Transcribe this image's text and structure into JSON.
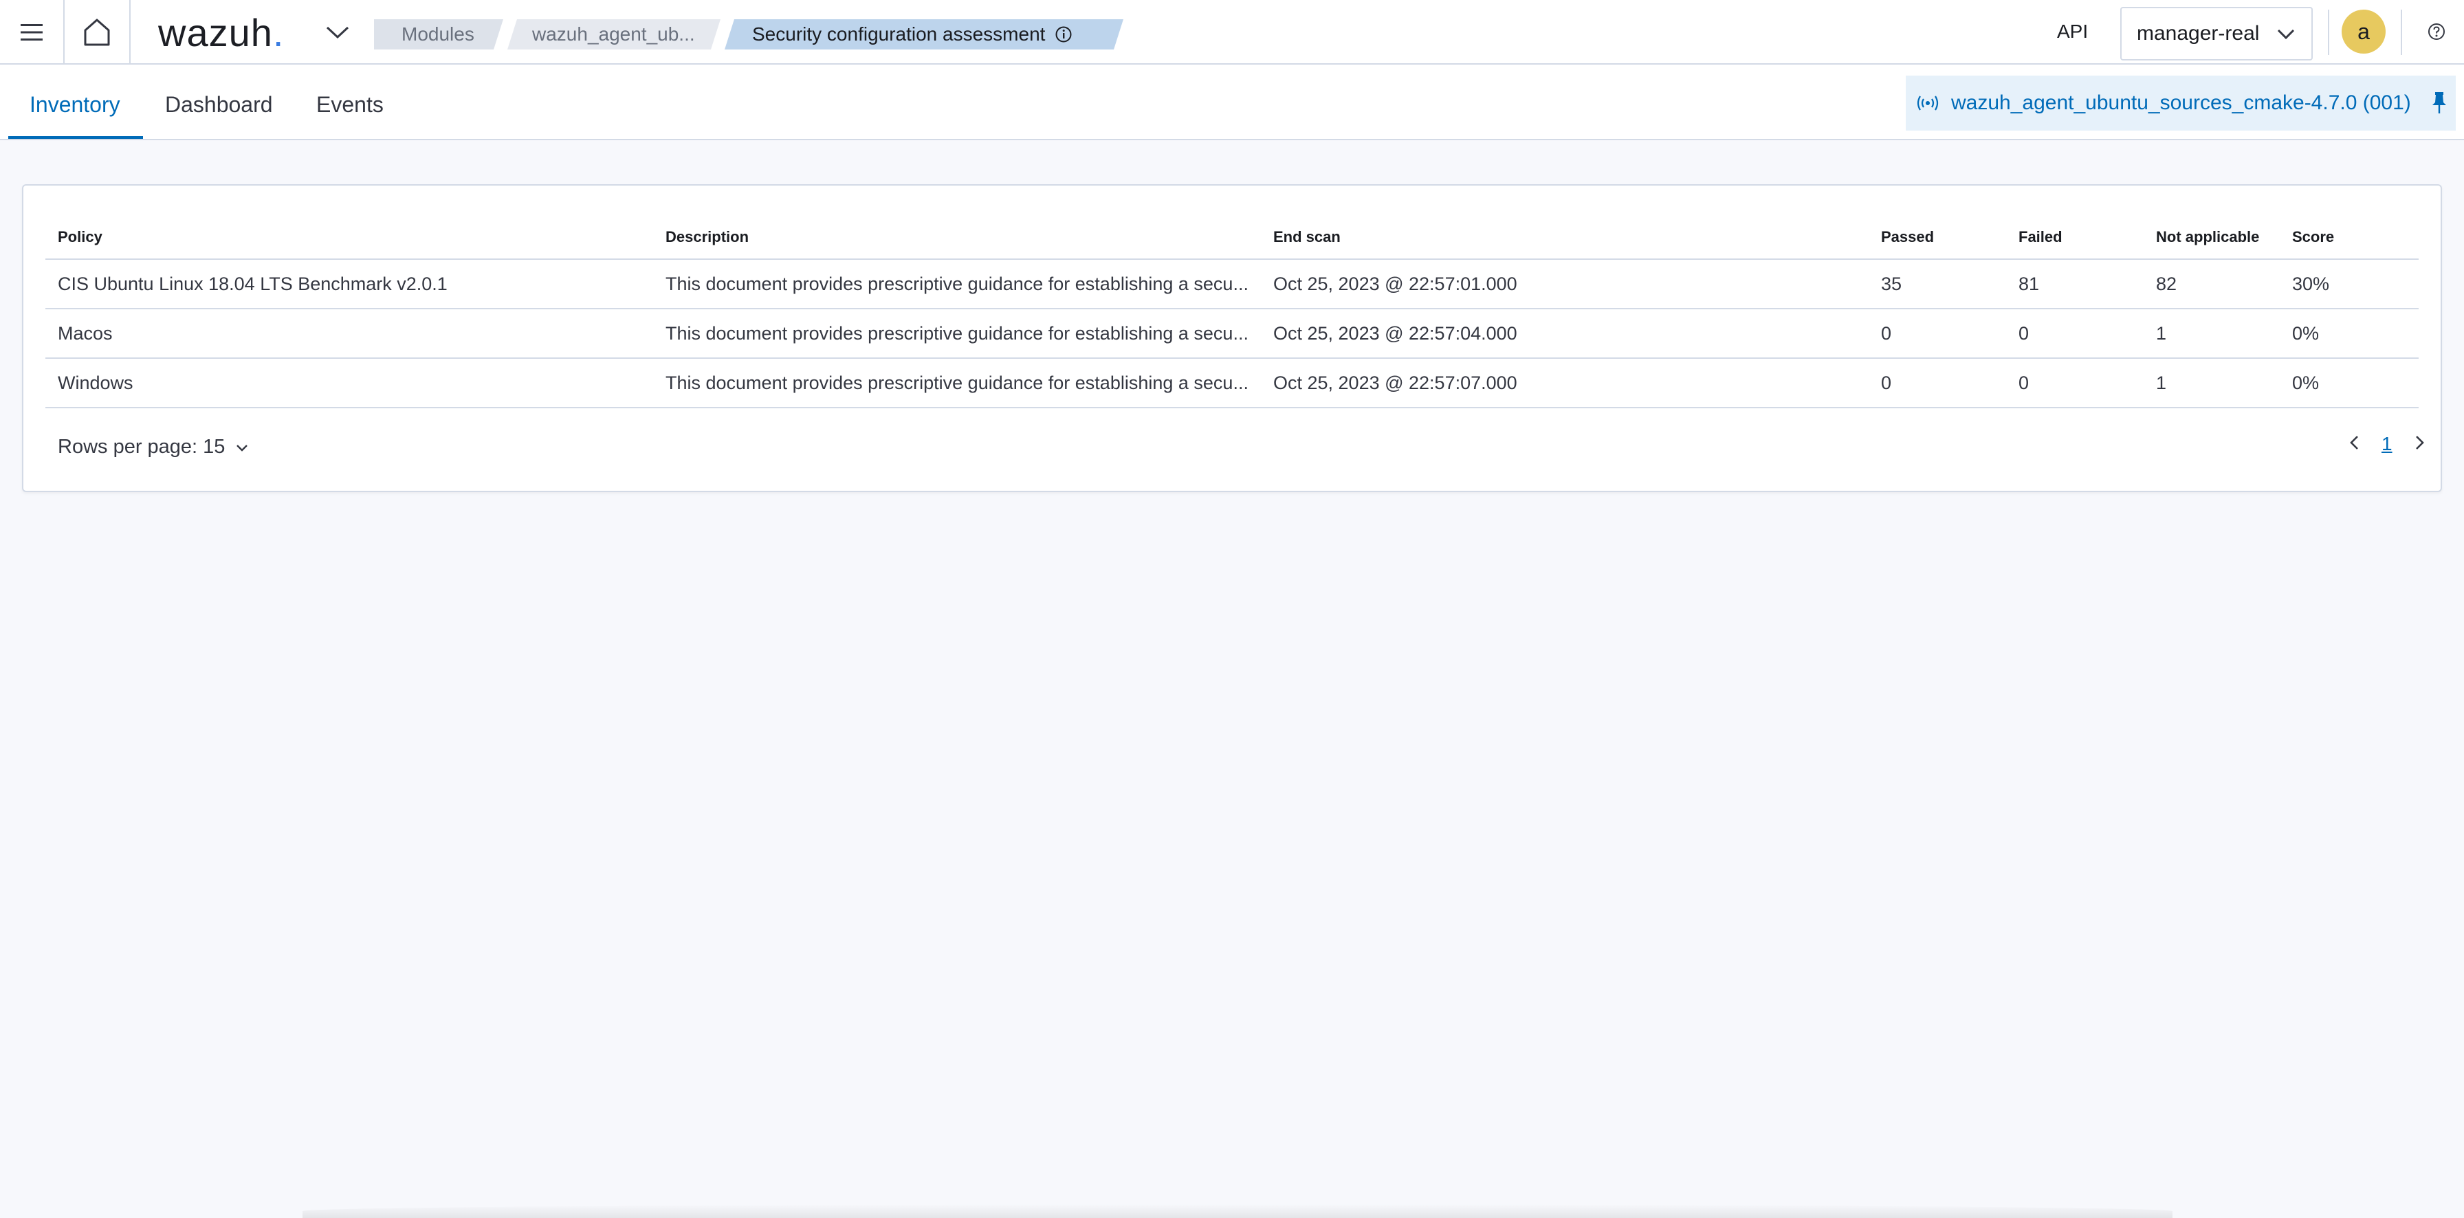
{
  "header": {
    "logo_text": "wazuh",
    "logo_dot": ".",
    "breadcrumbs": [
      "Modules",
      "wazuh_agent_ub...",
      "Security configuration assessment"
    ],
    "api_label": "API",
    "api_selected": "manager-real",
    "avatar_initial": "a"
  },
  "tabs": [
    {
      "label": "Inventory",
      "active": true
    },
    {
      "label": "Dashboard",
      "active": false
    },
    {
      "label": "Events",
      "active": false
    }
  ],
  "agent": {
    "label": "wazuh_agent_ubuntu_sources_cmake-4.7.0 (001)"
  },
  "table": {
    "columns": [
      "Policy",
      "Description",
      "End scan",
      "Passed",
      "Failed",
      "Not applicable",
      "Score"
    ],
    "rows": [
      {
        "policy": "CIS Ubuntu Linux 18.04 LTS Benchmark v2.0.1",
        "description": "This document provides prescriptive guidance for establishing a secu...",
        "end_scan": "Oct 25, 2023 @ 22:57:01.000",
        "passed": "35",
        "failed": "81",
        "not_applicable": "82",
        "score": "30%"
      },
      {
        "policy": "Macos",
        "description": "This document provides prescriptive guidance for establishing a secu...",
        "end_scan": "Oct 25, 2023 @ 22:57:04.000",
        "passed": "0",
        "failed": "0",
        "not_applicable": "1",
        "score": "0%"
      },
      {
        "policy": "Windows",
        "description": "This document provides prescriptive guidance for establishing a secu...",
        "end_scan": "Oct 25, 2023 @ 22:57:07.000",
        "passed": "0",
        "failed": "0",
        "not_applicable": "1",
        "score": "0%"
      }
    ]
  },
  "pagination": {
    "rows_per_page_label": "Rows per page: 15",
    "current_page": "1"
  },
  "colors": {
    "accent": "#006bb8",
    "breadcrumb_active": "#bdd4ec",
    "avatar": "#e7c95f",
    "logo_dot": "#3a7ce1"
  }
}
